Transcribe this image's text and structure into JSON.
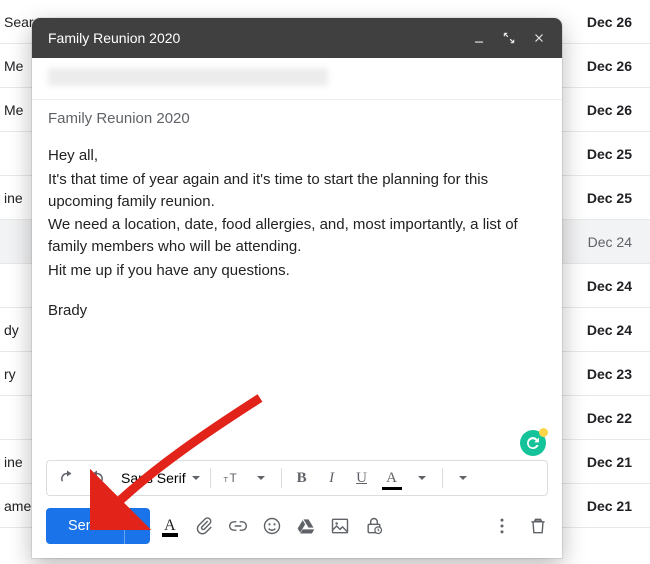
{
  "inbox_rows": [
    {
      "left": "Searc",
      "right": "Dec 26"
    },
    {
      "left": "Me",
      "right": "Dec 26"
    },
    {
      "left": "Me",
      "right": "Dec 26"
    },
    {
      "left": "",
      "right": "Dec 25"
    },
    {
      "left": "ine",
      "right": "Dec 25"
    },
    {
      "left": "",
      "right": "Dec 24",
      "highlight": true
    },
    {
      "left": "",
      "right": "Dec 24"
    },
    {
      "left": "dy",
      "right": "Dec 24"
    },
    {
      "left": "ry",
      "right": "Dec 23"
    },
    {
      "left": "",
      "right": "Dec 22"
    },
    {
      "left": "ine",
      "right": "Dec 21"
    },
    {
      "left": "ame",
      "right": "Dec 21"
    }
  ],
  "compose": {
    "title": "Family Reunion 2020",
    "subject": "Family Reunion 2020",
    "body": {
      "greeting": "Hey all,",
      "p1": "It's that time of year again and it's time to start the planning for this upcoming family reunion.",
      "p2": "We need a location, date, food allergies, and, most importantly, a list of family members who will be attending.",
      "p3": "Hit me up if you have any questions.",
      "signoff": "Brady"
    },
    "font_name": "Sans Serif",
    "send_label": "Send"
  }
}
